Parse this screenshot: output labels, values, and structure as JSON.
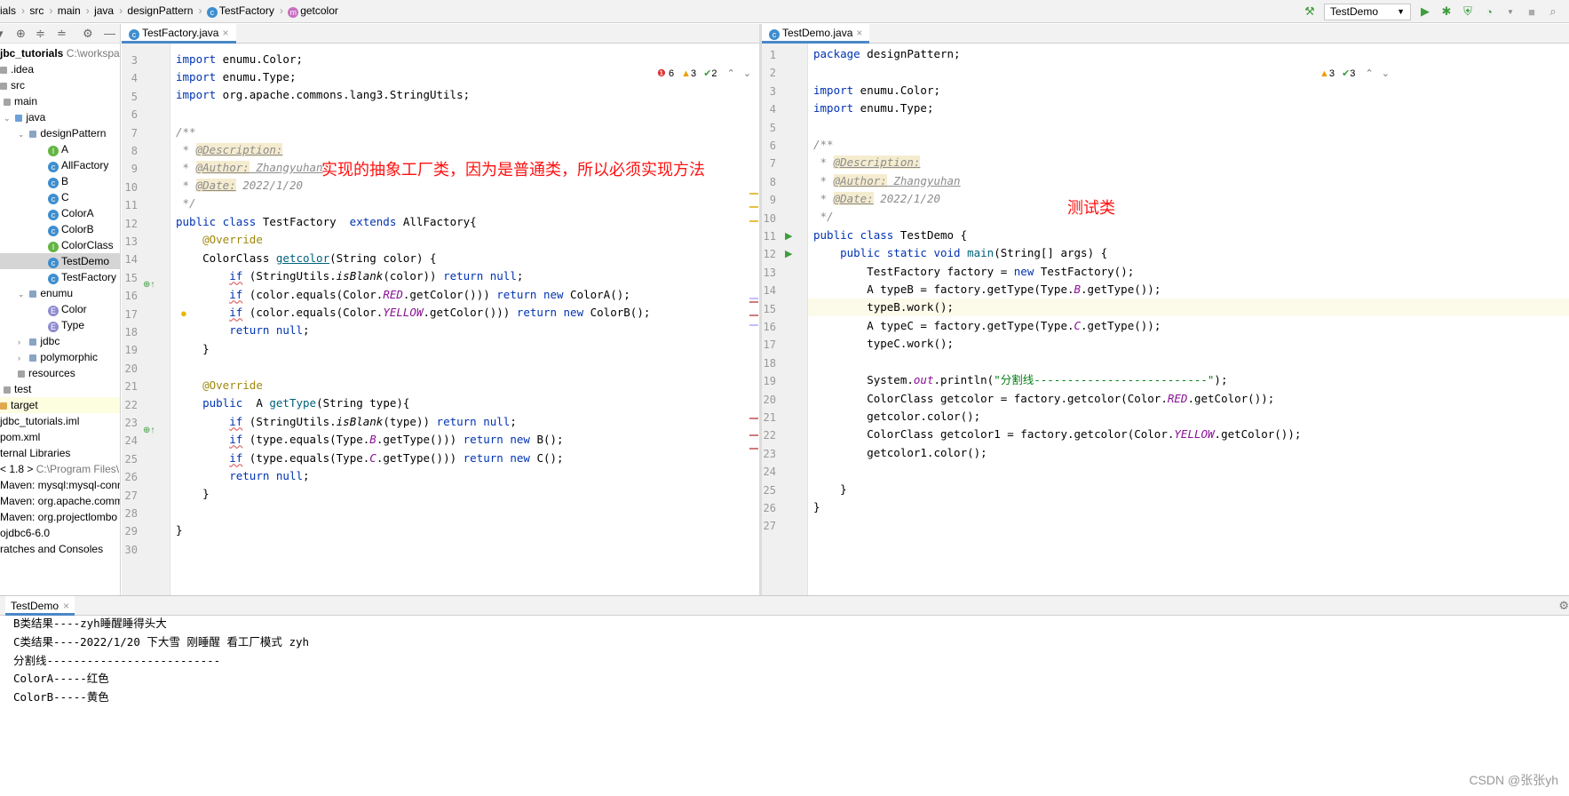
{
  "breadcrumb": [
    "ials",
    "src",
    "main",
    "java",
    "designPattern",
    "TestFactory",
    "getcolor"
  ],
  "run_config": "TestDemo",
  "project_tree": [
    {
      "label": "jbc_tutorials",
      "extra": "C:\\workspace",
      "bold": true
    },
    {
      "label": ".idea"
    },
    {
      "label": "src"
    },
    {
      "label": "main"
    },
    {
      "label": "java"
    },
    {
      "label": "designPattern"
    },
    {
      "label": "A",
      "kind": "I"
    },
    {
      "label": "AllFactory",
      "kind": "C"
    },
    {
      "label": "B",
      "kind": "C"
    },
    {
      "label": "C",
      "kind": "C"
    },
    {
      "label": "ColorA",
      "kind": "C"
    },
    {
      "label": "ColorB",
      "kind": "C"
    },
    {
      "label": "ColorClass",
      "kind": "I"
    },
    {
      "label": "TestDemo",
      "kind": "C"
    },
    {
      "label": "TestFactory",
      "kind": "C"
    },
    {
      "label": "enumu"
    },
    {
      "label": "Color",
      "kind": "E"
    },
    {
      "label": "Type",
      "kind": "E"
    },
    {
      "label": "jdbc"
    },
    {
      "label": "polymorphic"
    },
    {
      "label": "resources"
    },
    {
      "label": "test"
    },
    {
      "label": "target"
    },
    {
      "label": "jdbc_tutorials.iml"
    },
    {
      "label": "pom.xml"
    },
    {
      "label": "ternal Libraries"
    },
    {
      "label": "< 1.8 >",
      "extra": "C:\\Program Files\\"
    },
    {
      "label": "Maven: mysql:mysql-conn"
    },
    {
      "label": "Maven: org.apache.comm"
    },
    {
      "label": "Maven: org.projectlombo"
    },
    {
      "label": "ojdbc6-6.0"
    },
    {
      "label": "ratches and Consoles"
    }
  ],
  "left_editor": {
    "tab": "TestFactory.java",
    "inspections": {
      "errors": "6",
      "warnings": "3",
      "ok": "2"
    },
    "annotation": "实现的抽象工厂类，因为是普通类，所以必须实现方法",
    "line_numbers": [
      "3",
      "4",
      "5",
      "6",
      "7",
      "8",
      "9",
      "10",
      "11",
      "12",
      "13",
      "14",
      "15",
      "16",
      "17",
      "18",
      "19",
      "20",
      "21",
      "22",
      "23",
      "24",
      "25",
      "26",
      "27",
      "28",
      "29",
      "30"
    ]
  },
  "right_editor": {
    "tab": "TestDemo.java",
    "inspections": {
      "warnings": "3",
      "ok": "3"
    },
    "annotation": "测试类",
    "line_numbers": [
      "1",
      "2",
      "3",
      "4",
      "5",
      "6",
      "7",
      "8",
      "9",
      "10",
      "11",
      "12",
      "13",
      "14",
      "15",
      "16",
      "17",
      "18",
      "19",
      "20",
      "21",
      "22",
      "23",
      "24",
      "25",
      "26",
      "27"
    ]
  },
  "console": {
    "tab": "TestDemo",
    "lines": [
      "B类结果----zyh睡醒睡得头大",
      "C类结果----2022/1/20 下大雪 刚睡醒 看工厂模式 zyh",
      "分割线--------------------------",
      "ColorA-----红色",
      "ColorB-----黄色"
    ]
  },
  "watermark": "CSDN @张张yh"
}
